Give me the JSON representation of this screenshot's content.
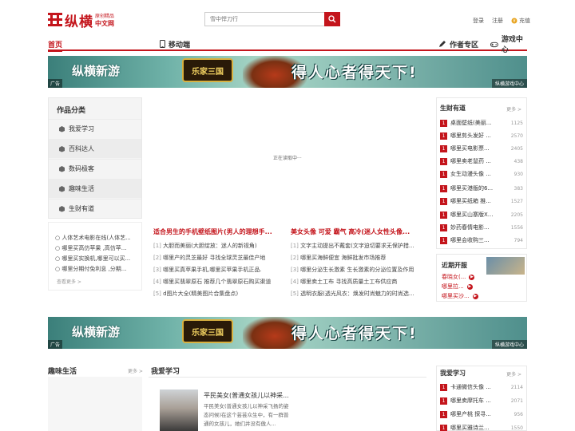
{
  "header": {
    "logo_text": "纵横",
    "logo_sub_top": "原创精品",
    "logo_sub_bottom": "中文网",
    "search_placeholder": "雪中悍刀行",
    "login": "登录",
    "register": "注册",
    "recharge": "充值"
  },
  "nav": {
    "home": "首页",
    "mobile": "移动端",
    "author": "作者专区",
    "games": "游戏中心"
  },
  "banner": {
    "left_text": "纵横新游",
    "logo_text": "乐家三国",
    "slogan": "得人心者得天下!",
    "ad_tag": "广告",
    "source": "纵横游戏中心"
  },
  "category": {
    "title": "作品分类",
    "items": [
      "我爱学习",
      "百科达人",
      "数码极客",
      "趣味生活",
      "生财有道"
    ]
  },
  "cat_list": {
    "items": [
      "人体艺术电影在线(人体艺...",
      "哪里买高仿苹果 ,高仿苹...",
      "哪里买实换机,哪里可以买...",
      "哪里分期付免利息 ,分期..."
    ],
    "more": "查看更多 >"
  },
  "loading": "正在读取中···",
  "mid_left": {
    "title": "适合男生的手机壁纸图片(男人的理想手...",
    "items": [
      {
        "n": "[1]",
        "t": "大胆而美丽(大胆绽放：迷人的新视角)"
      },
      {
        "n": "[2]",
        "t": "哪里产的灵芝最好 寻找全球灵芝最佳产地"
      },
      {
        "n": "[3]",
        "t": "哪里买真苹果手机,哪里买苹果手机正品."
      },
      {
        "n": "[4]",
        "t": "哪里买翡翠原石 推荐几个翡翠原石购买渠道"
      },
      {
        "n": "[5]",
        "t": "d图片大全(精美图片合集盘点)"
      }
    ]
  },
  "mid_right": {
    "title": "美女头像 可爱 霸气 高冷(迷人女性头像...",
    "items": [
      {
        "n": "[1]",
        "t": "文字主动提出不戴套(文字迫切要求无保护措..."
      },
      {
        "n": "[2]",
        "t": "哪里买海鲜便宜 海鲜批发市场推荐"
      },
      {
        "n": "[3]",
        "t": "哪里分泌生长激素 生长激素的分泌位置及作用"
      },
      {
        "n": "[4]",
        "t": "哪里卖土工布 寻找高质量土工布供应商"
      },
      {
        "n": "[5]",
        "t": "透明衣服(透光风衣：焕发时尚魅力的时尚选..."
      }
    ]
  },
  "rank1": {
    "title": "生财有道",
    "more": "更多 >",
    "rows": [
      {
        "num": "1",
        "t": "桌面壁纸(美丽...",
        "c": "1125"
      },
      {
        "num": "1",
        "t": "哪里剪头发好 ...",
        "c": "2570"
      },
      {
        "num": "1",
        "t": "哪里买电影票...",
        "c": "2405"
      },
      {
        "num": "1",
        "t": "哪里卖老鼠药 ...",
        "c": "438"
      },
      {
        "num": "1",
        "t": "女生动漫头像 ...",
        "c": "930"
      },
      {
        "num": "1",
        "t": "哪里买港版的6...",
        "c": "383"
      },
      {
        "num": "1",
        "t": "哪里买纸箱 推...",
        "c": "1527"
      },
      {
        "num": "1",
        "t": "哪里买山寨版X...",
        "c": "2205"
      },
      {
        "num": "1",
        "t": "妙药春情电影...",
        "c": "1556"
      },
      {
        "num": "1",
        "t": "哪里会收购三...",
        "c": "794"
      }
    ]
  },
  "recent": {
    "title": "近期开服",
    "rows": [
      "春晓女(...",
      "哪里拉...",
      "哪里买沙..."
    ],
    "dot": "▶"
  },
  "lower": {
    "life_title": "趣味生活",
    "life_more": "更多 >",
    "love_title": "我爱学习",
    "love_name": "平民美女(普通女孩儿以神采...",
    "love_desc": "平民美女(普通女孩儿以神采飞扬的姿态问候)在这个芸芸众生中，有一群普通的女孩儿，她们并没有傲人..."
  },
  "rank3": {
    "title": "我爱学习",
    "more": "更多 >",
    "rows": [
      {
        "num": "1",
        "t": "卡通微信头像 ...",
        "c": "2114"
      },
      {
        "num": "1",
        "t": "哪里卖摩托车 ...",
        "c": "2071"
      },
      {
        "num": "1",
        "t": "哪里产桃 探寻...",
        "c": "956"
      },
      {
        "num": "1",
        "t": "哪里买雅诗兰...",
        "c": "1550"
      }
    ]
  }
}
